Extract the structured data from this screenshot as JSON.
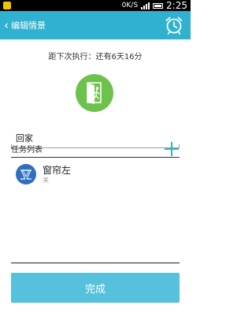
{
  "status_bar": {
    "network_speed": "0K/S",
    "time": "2:25"
  },
  "header": {
    "title": "编辑情景",
    "back_icon": "chevron-left-icon",
    "alarm_icon": "alarm-clock-icon"
  },
  "countdown_text": "距下次执行：还有6天16分",
  "scene": {
    "icon": "door-exit-icon",
    "name": "回家"
  },
  "task_list": {
    "title": "任务列表",
    "add_icon": "plus-icon",
    "items": [
      {
        "name": "窗帘左",
        "state": "关",
        "icon": "curtain-icon"
      }
    ]
  },
  "done_label": "完成",
  "colors": {
    "accent": "#2fb1cf",
    "scene_icon_bg": "#6cc24a",
    "button_bg": "#56c1dd",
    "curtain_icon_bg": "#2f6fbe"
  }
}
